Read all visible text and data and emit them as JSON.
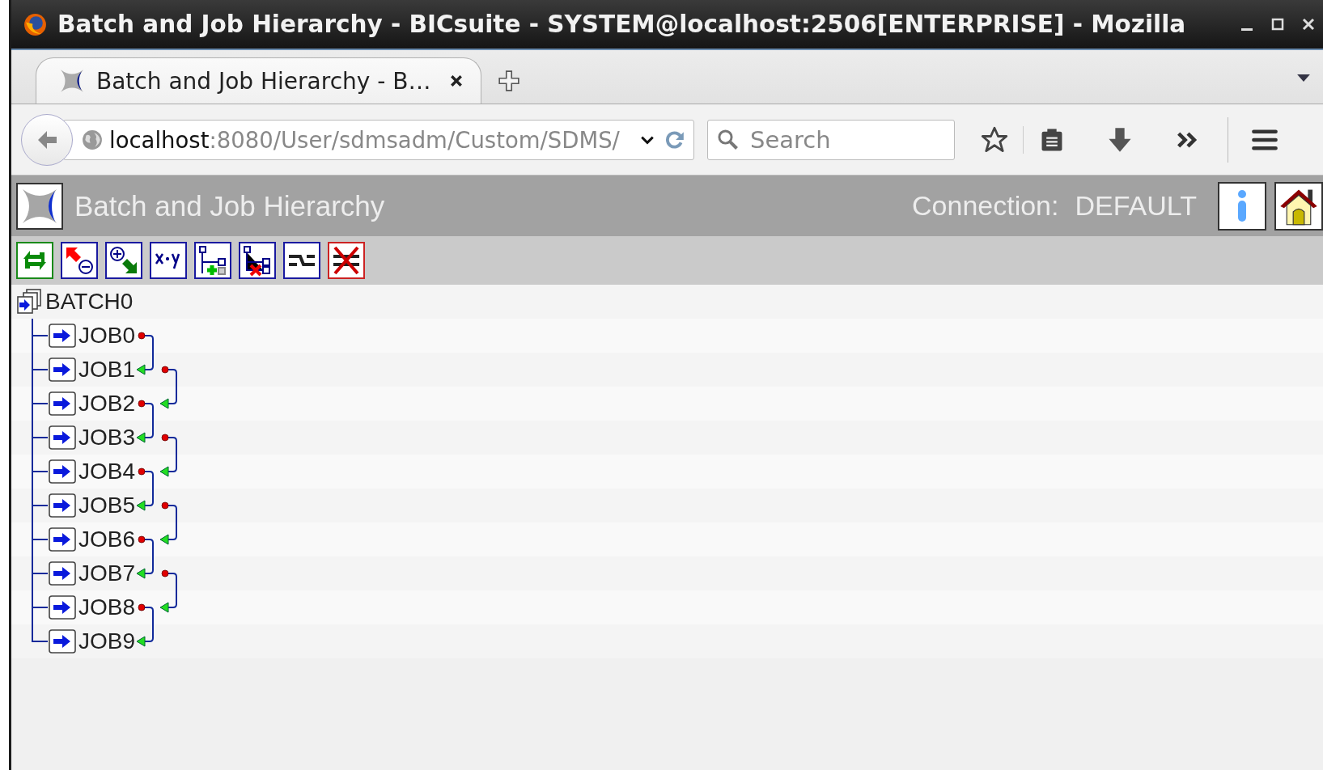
{
  "window": {
    "title": "Batch and Job Hierarchy - BICsuite - SYSTEM@localhost:2506[ENTERPRISE] - Mozilla"
  },
  "tabs": [
    {
      "label": "Batch and Job Hierarchy - B…",
      "selected": true
    }
  ],
  "address_bar": {
    "host": "localhost",
    "path": ":8080/User/sdmsadm/Custom/SDMS/"
  },
  "search": {
    "placeholder": "Search"
  },
  "app_header": {
    "title": "Batch and Job Hierarchy",
    "connection_label": "Connection:",
    "connection_value": "DEFAULT"
  },
  "toolbar": [
    {
      "kind": "refresh"
    },
    {
      "kind": "collapse"
    },
    {
      "kind": "expand"
    },
    {
      "kind": "formula"
    },
    {
      "kind": "add-child"
    },
    {
      "kind": "remove-child"
    },
    {
      "kind": "link"
    },
    {
      "kind": "unlink"
    }
  ],
  "tree": {
    "root": {
      "name": "BATCH0",
      "children": [
        {
          "name": "JOB0",
          "has_predecessor": false,
          "has_successor": true
        },
        {
          "name": "JOB1",
          "has_predecessor": true,
          "has_successor": true
        },
        {
          "name": "JOB2",
          "has_predecessor": true,
          "has_successor": true
        },
        {
          "name": "JOB3",
          "has_predecessor": true,
          "has_successor": true
        },
        {
          "name": "JOB4",
          "has_predecessor": true,
          "has_successor": true
        },
        {
          "name": "JOB5",
          "has_predecessor": true,
          "has_successor": true
        },
        {
          "name": "JOB6",
          "has_predecessor": true,
          "has_successor": true
        },
        {
          "name": "JOB7",
          "has_predecessor": true,
          "has_successor": true
        },
        {
          "name": "JOB8",
          "has_predecessor": true,
          "has_successor": true
        },
        {
          "name": "JOB9",
          "has_predecessor": true,
          "has_successor": false
        }
      ]
    }
  }
}
